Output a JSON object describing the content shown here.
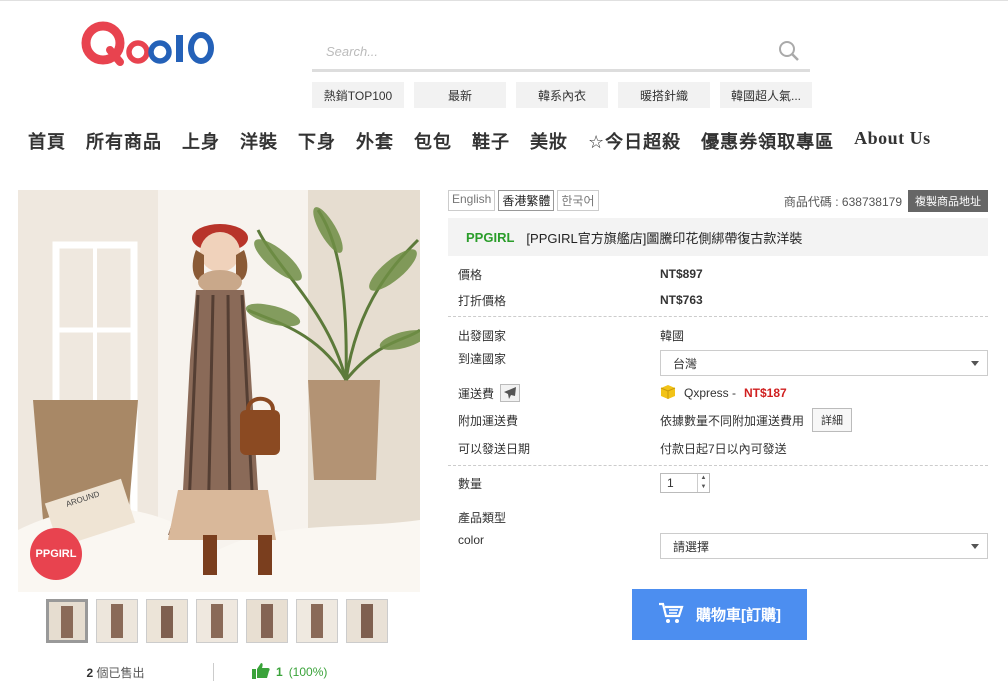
{
  "header": {
    "logo_text": "Qoo10",
    "search": {
      "placeholder": "Search..."
    },
    "hot_tags": [
      "熱銷TOP100",
      "最新",
      "韓系內衣",
      "暖搭針織",
      "韓國超人氣..."
    ]
  },
  "nav": {
    "items": [
      "首頁",
      "所有商品",
      "上身",
      "洋裝",
      "下身",
      "外套",
      "包包",
      "鞋子",
      "美妝",
      "☆今日超殺",
      "優惠券領取專區",
      "About Us"
    ]
  },
  "gallery": {
    "badge": "PPGIRL",
    "thumb_count": 7,
    "sold_count": "2",
    "sold_label": " 個已售出",
    "likes_count": "1",
    "likes_pct": "(100%)"
  },
  "product": {
    "languages": [
      "English",
      "香港繁體",
      "한국어"
    ],
    "active_language": "香港繁體",
    "code_label": "商品代碼 : 638738179",
    "copy_button": "複製商品地址",
    "shop_name": "PPGIRL",
    "title": "[PPGIRL官方旗艦店]圖騰印花側綁帶復古款洋裝",
    "price_label": "價格",
    "price": "NT$897",
    "discount_label": "打折價格",
    "discount_price": "NT$763",
    "origin_label": "出發國家",
    "origin": "韓國",
    "dest_label": "到達國家",
    "dest": "台灣",
    "shipping_label": "運送費",
    "shipping_method": "Qxpress -",
    "shipping_fee": "NT$187",
    "extra_fee_label": "附加運送費",
    "extra_fee": "依據數量不同附加運送費用",
    "detail_button": "詳細",
    "ship_date_label": "可以發送日期",
    "ship_date": "付款日起7日以內可發送",
    "qty_label": "數量",
    "qty": "1",
    "type_label": "產品類型",
    "color_label": "color",
    "color_select": "請選擇",
    "cart_button": "購物車[訂購]"
  },
  "colors": {
    "logo_red": "#e8434f",
    "logo_blue": "#2461b8",
    "shop_green": "#2a9d2a",
    "price_red": "#d02020",
    "cart_blue": "#4c8ef0"
  }
}
